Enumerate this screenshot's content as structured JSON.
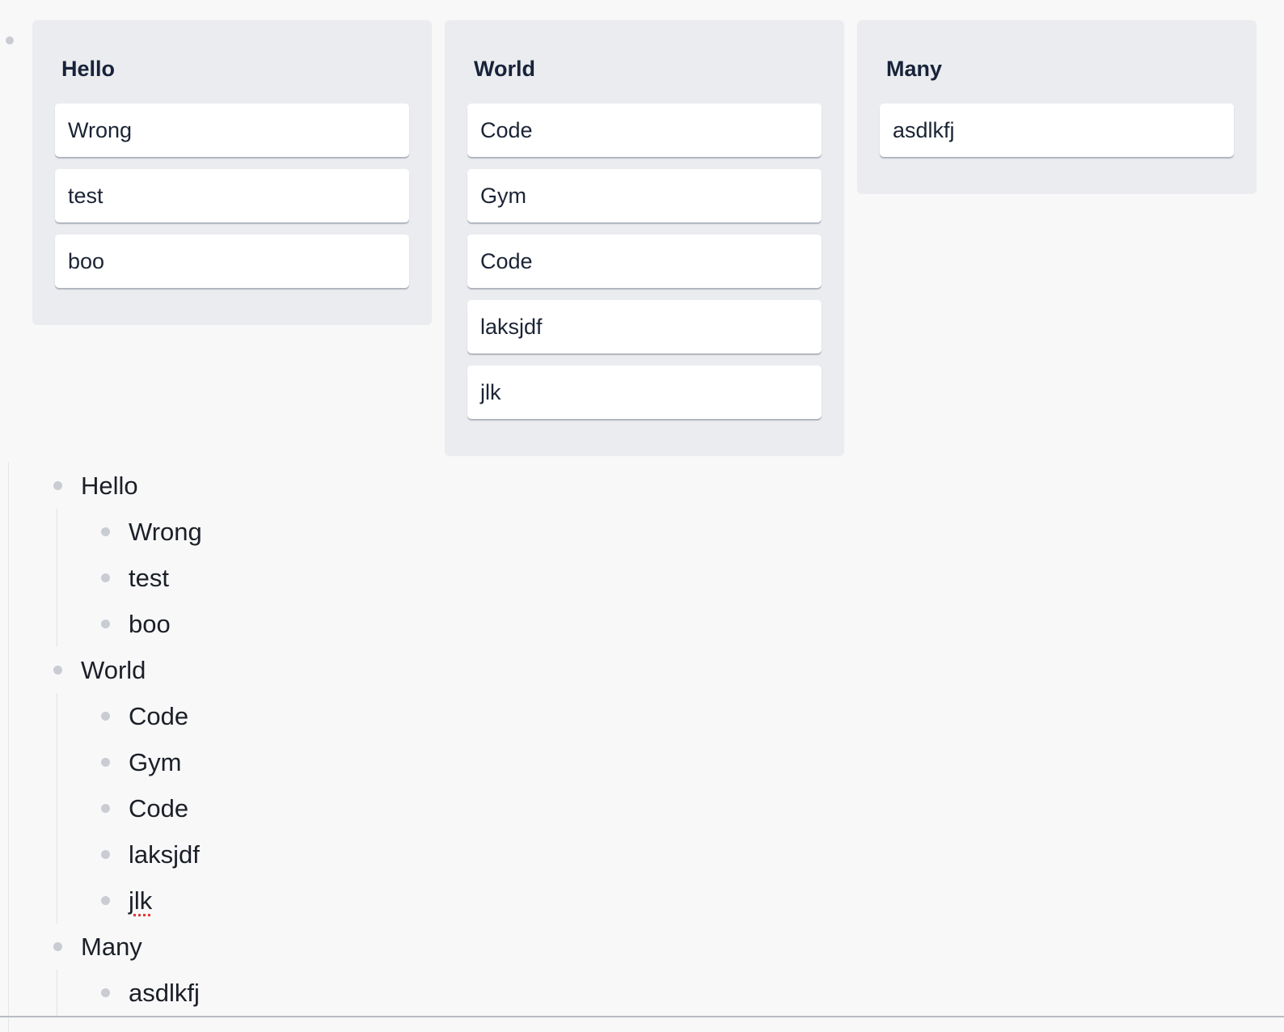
{
  "board": {
    "columns": [
      {
        "title": "Hello",
        "cards": [
          "Wrong",
          "test",
          "boo"
        ]
      },
      {
        "title": "World",
        "cards": [
          "Code",
          "Gym",
          "Code",
          "laksjdf",
          "jlk"
        ]
      },
      {
        "title": "Many",
        "cards": [
          "asdlkfj"
        ]
      }
    ]
  },
  "outline": {
    "items": [
      {
        "label": "Hello",
        "children": [
          "Wrong",
          "test",
          "boo"
        ]
      },
      {
        "label": "World",
        "children": [
          "Code",
          "Gym",
          "Code",
          "laksjdf",
          "jlk"
        ]
      },
      {
        "label": "Many",
        "children": [
          "asdlkfj"
        ]
      }
    ]
  }
}
